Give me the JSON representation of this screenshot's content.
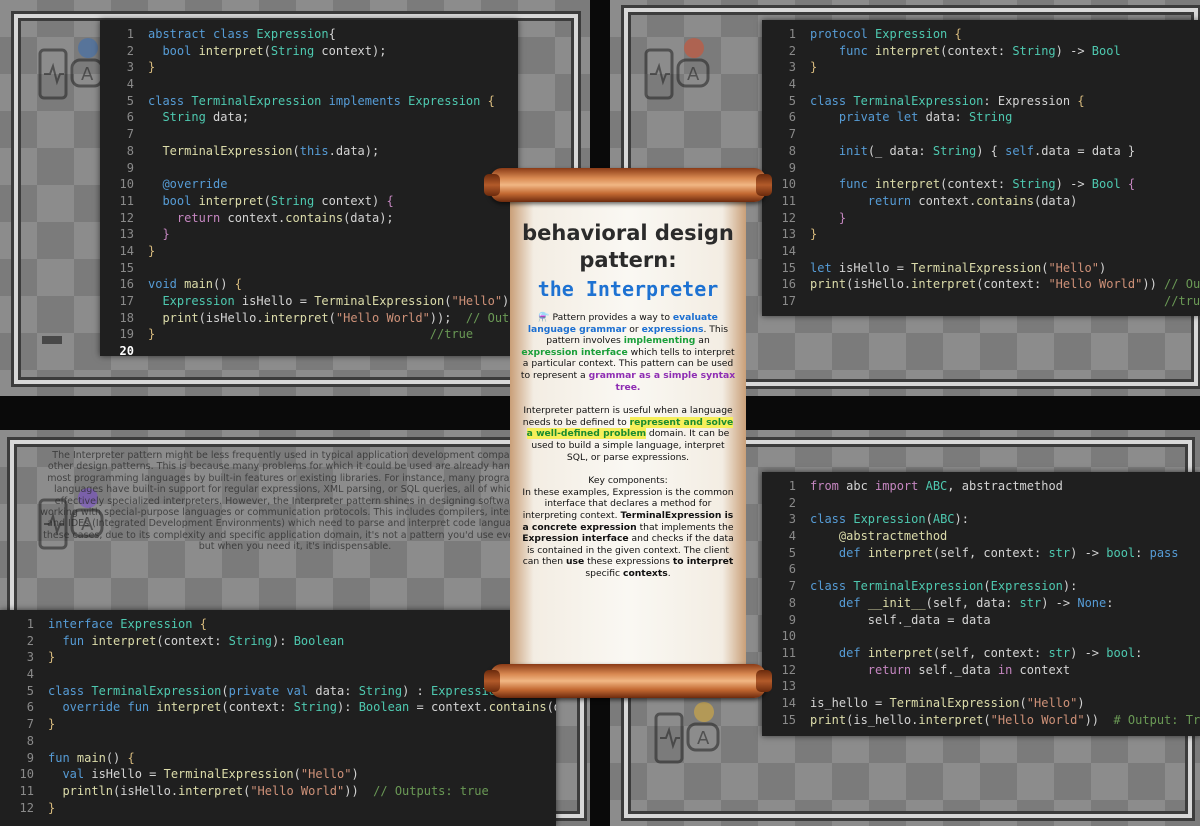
{
  "scroll": {
    "title_line1": "behavioral design",
    "title_line2": "pattern:",
    "title_line3": "the Interpreter",
    "p1_prefix": "⚗️ Pattern  provides a way to ",
    "p1_hl1": "evaluate language grammar",
    "p1_t1": " or ",
    "p1_hl2": "expressions",
    "p1_t2": ". This pattern involves ",
    "p1_hl3": "implementing",
    "p1_t3": " an ",
    "p1_hl4": "expression interface",
    "p1_t4": " which tells to interpret a particular context. This pattern can be used to represent a ",
    "p1_hl5": "grammar as a simple syntax tree.",
    "p2_t1": "Interpreter pattern is useful when a language needs to be defined to ",
    "p2_hl1": "represent and solve a well-defined problem",
    "p2_t2": " domain. It can be used to build a simple language, interpret SQL, or parse expressions.",
    "p3_heading": "Key components:",
    "p3_t1": "In these examples, Expression is the common interface that declares a method for interpreting context.",
    "p3_b1": "TerminalExpression is a concrete expression",
    "p3_t2": " that implements the ",
    "p3_b2": "Expression interface",
    "p3_t3": " and checks if the data is contained in the given context. The client can then ",
    "p3_b3": "use",
    "p3_t4": " these expressions ",
    "p3_b4": "to interpret",
    "p3_t5": " specific ",
    "p3_b5": "contexts",
    "p3_t6": "."
  },
  "side_text": "The Interpreter pattern might be less frequently used in typical application development compared to other design patterns. This is because many problems for which it could be used are already handled in most programming languages by built-in features or existing libraries. For instance, many programming languages have built-in support for regular expressions, XML parsing, or SQL queries, all of which are effectively specialized interpreters. However, the Interpreter pattern shines in designing software for working with special-purpose languages or communication protocols. This includes compilers, interpreters, and IDEs (Integrated Development Environments) which need to parse and interpret code languages. In these cases, due to its complexity and specific application domain, it's not a pattern you'd use every day, but when you need it, it's indispensable.",
  "code_dart": [
    [
      [
        "k",
        "abstract class "
      ],
      [
        "t",
        "Expression"
      ],
      [
        "",
        "{"
      ]
    ],
    [
      [
        "",
        "  "
      ],
      [
        "k",
        "bool "
      ],
      [
        "f",
        "interpret"
      ],
      [
        "",
        "("
      ],
      [
        "t",
        "String"
      ],
      [
        "",
        " context);"
      ]
    ],
    [
      [
        "y",
        "}"
      ]
    ],
    [],
    [
      [
        "k",
        "class "
      ],
      [
        "t",
        "TerminalExpression "
      ],
      [
        "k",
        "implements "
      ],
      [
        "t",
        "Expression "
      ],
      [
        "y",
        "{"
      ]
    ],
    [
      [
        "",
        "  "
      ],
      [
        "t",
        "String"
      ],
      [
        "",
        " data;"
      ]
    ],
    [],
    [
      [
        "",
        "  "
      ],
      [
        "f",
        "TerminalExpression"
      ],
      [
        "",
        "("
      ],
      [
        "k",
        "this"
      ],
      [
        "",
        ".data);"
      ]
    ],
    [],
    [
      [
        "",
        "  "
      ],
      [
        "k",
        "@override"
      ]
    ],
    [
      [
        "",
        "  "
      ],
      [
        "k",
        "bool "
      ],
      [
        "f",
        "interpret"
      ],
      [
        "",
        "("
      ],
      [
        "t",
        "String"
      ],
      [
        "",
        " context) "
      ],
      [
        "p",
        "{"
      ]
    ],
    [
      [
        "",
        "    "
      ],
      [
        "p",
        "return "
      ],
      [
        "",
        "context."
      ],
      [
        "f",
        "contains"
      ],
      [
        "",
        "(data);"
      ]
    ],
    [
      [
        "",
        "  "
      ],
      [
        "p",
        "}"
      ]
    ],
    [
      [
        "y",
        "}"
      ]
    ],
    [],
    [
      [
        "k",
        "void "
      ],
      [
        "f",
        "main"
      ],
      [
        "",
        "() "
      ],
      [
        "y",
        "{"
      ]
    ],
    [
      [
        "",
        "  "
      ],
      [
        "t",
        "Expression"
      ],
      [
        "",
        " isHello = "
      ],
      [
        "f",
        "TerminalExpression"
      ],
      [
        "",
        "("
      ],
      [
        "s",
        "\"Hello\""
      ],
      [
        "",
        ");"
      ]
    ],
    [
      [
        "",
        "  "
      ],
      [
        "f",
        "print"
      ],
      [
        "",
        "(isHello."
      ],
      [
        "f",
        "interpret"
      ],
      [
        "",
        "("
      ],
      [
        "s",
        "\"Hello World\""
      ],
      [
        "",
        "));  "
      ],
      [
        "c",
        "// Outputs:"
      ]
    ],
    [
      [
        "y",
        "}"
      ],
      [
        "",
        "                                      "
      ],
      [
        "c",
        "//true"
      ]
    ],
    []
  ],
  "code_swift": [
    [
      [
        "k",
        "protocol "
      ],
      [
        "t",
        "Expression "
      ],
      [
        "y",
        "{"
      ]
    ],
    [
      [
        "",
        "    "
      ],
      [
        "k",
        "func "
      ],
      [
        "f",
        "interpret"
      ],
      [
        "",
        "(context: "
      ],
      [
        "t",
        "String"
      ],
      [
        "",
        ") -> "
      ],
      [
        "t",
        "Bool"
      ]
    ],
    [
      [
        "y",
        "}"
      ]
    ],
    [],
    [
      [
        "k",
        "class "
      ],
      [
        "t",
        "TerminalExpression"
      ],
      [
        "",
        ": Expression "
      ],
      [
        "y",
        "{"
      ]
    ],
    [
      [
        "",
        "    "
      ],
      [
        "k",
        "private let "
      ],
      [
        "",
        "data: "
      ],
      [
        "t",
        "String"
      ]
    ],
    [],
    [
      [
        "",
        "    "
      ],
      [
        "k",
        "init"
      ],
      [
        "",
        "(_ data: "
      ],
      [
        "t",
        "String"
      ],
      [
        "",
        ") { "
      ],
      [
        "k",
        "self"
      ],
      [
        "",
        ".data = data }"
      ]
    ],
    [],
    [
      [
        "",
        "    "
      ],
      [
        "k",
        "func "
      ],
      [
        "f",
        "interpret"
      ],
      [
        "",
        "(context: "
      ],
      [
        "t",
        "String"
      ],
      [
        "",
        ") -> "
      ],
      [
        "t",
        "Bool "
      ],
      [
        "p",
        "{"
      ]
    ],
    [
      [
        "",
        "        "
      ],
      [
        "k",
        "return "
      ],
      [
        "",
        "context."
      ],
      [
        "f",
        "contains"
      ],
      [
        "",
        "(data)"
      ]
    ],
    [
      [
        "",
        "    "
      ],
      [
        "p",
        "}"
      ]
    ],
    [
      [
        "y",
        "}"
      ]
    ],
    [],
    [
      [
        "k",
        "let "
      ],
      [
        "",
        "isHello = "
      ],
      [
        "f",
        "TerminalExpression"
      ],
      [
        "",
        "("
      ],
      [
        "s",
        "\"Hello\""
      ],
      [
        "",
        ")"
      ]
    ],
    [
      [
        "f",
        "print"
      ],
      [
        "",
        "(isHello."
      ],
      [
        "f",
        "interpret"
      ],
      [
        "",
        "(context: "
      ],
      [
        "s",
        "\"Hello World\""
      ],
      [
        "",
        ")) "
      ],
      [
        "c",
        "// Outputs:"
      ]
    ],
    [
      [
        "",
        "                                                 "
      ],
      [
        "c",
        "//true"
      ]
    ]
  ],
  "code_kotlin": [
    [
      [
        "k",
        "interface "
      ],
      [
        "t",
        "Expression "
      ],
      [
        "y",
        "{"
      ]
    ],
    [
      [
        "",
        "  "
      ],
      [
        "k",
        "fun "
      ],
      [
        "f",
        "interpret"
      ],
      [
        "",
        "(context: "
      ],
      [
        "t",
        "String"
      ],
      [
        "",
        "): "
      ],
      [
        "t",
        "Boolean"
      ]
    ],
    [
      [
        "y",
        "}"
      ]
    ],
    [],
    [
      [
        "k",
        "class "
      ],
      [
        "t",
        "TerminalExpression"
      ],
      [
        "",
        "("
      ],
      [
        "k",
        "private val "
      ],
      [
        "",
        "data: "
      ],
      [
        "t",
        "String"
      ],
      [
        "",
        ") : "
      ],
      [
        "t",
        "Expression "
      ],
      [
        "y",
        "{"
      ]
    ],
    [
      [
        "",
        "  "
      ],
      [
        "k",
        "override fun "
      ],
      [
        "f",
        "interpret"
      ],
      [
        "",
        "(context: "
      ],
      [
        "t",
        "String"
      ],
      [
        "",
        "): "
      ],
      [
        "t",
        "Boolean"
      ],
      [
        "",
        " = context."
      ],
      [
        "f",
        "contains"
      ],
      [
        "",
        "(data)"
      ]
    ],
    [
      [
        "y",
        "}"
      ]
    ],
    [],
    [
      [
        "k",
        "fun "
      ],
      [
        "f",
        "main"
      ],
      [
        "",
        "() "
      ],
      [
        "y",
        "{"
      ]
    ],
    [
      [
        "",
        "  "
      ],
      [
        "k",
        "val "
      ],
      [
        "",
        "isHello = "
      ],
      [
        "f",
        "TerminalExpression"
      ],
      [
        "",
        "("
      ],
      [
        "s",
        "\"Hello\""
      ],
      [
        "",
        ")"
      ]
    ],
    [
      [
        "",
        "  "
      ],
      [
        "f",
        "println"
      ],
      [
        "",
        "(isHello."
      ],
      [
        "f",
        "interpret"
      ],
      [
        "",
        "("
      ],
      [
        "s",
        "\"Hello World\""
      ],
      [
        "",
        "))  "
      ],
      [
        "c",
        "// Outputs: true"
      ]
    ],
    [
      [
        "y",
        "}"
      ]
    ]
  ],
  "code_python": [
    [
      [
        "p",
        "from "
      ],
      [
        "",
        "abc "
      ],
      [
        "p",
        "import "
      ],
      [
        "t",
        "ABC"
      ],
      [
        "",
        ", abstractmethod"
      ]
    ],
    [],
    [
      [
        "k",
        "class "
      ],
      [
        "t",
        "Expression"
      ],
      [
        "",
        "("
      ],
      [
        "t",
        "ABC"
      ],
      [
        "",
        "):"
      ]
    ],
    [
      [
        "",
        "    "
      ],
      [
        "f",
        "@abstractmethod"
      ]
    ],
    [
      [
        "",
        "    "
      ],
      [
        "k",
        "def "
      ],
      [
        "f",
        "interpret"
      ],
      [
        "",
        "(self, context: "
      ],
      [
        "t",
        "str"
      ],
      [
        "",
        ") -> "
      ],
      [
        "t",
        "bool"
      ],
      [
        "",
        ": "
      ],
      [
        "k",
        "pass"
      ]
    ],
    [],
    [
      [
        "k",
        "class "
      ],
      [
        "t",
        "TerminalExpression"
      ],
      [
        "",
        "("
      ],
      [
        "t",
        "Expression"
      ],
      [
        "",
        "):"
      ]
    ],
    [
      [
        "",
        "    "
      ],
      [
        "k",
        "def "
      ],
      [
        "f",
        "__init__"
      ],
      [
        "",
        "(self, data: "
      ],
      [
        "t",
        "str"
      ],
      [
        "",
        ") -> "
      ],
      [
        "k",
        "None"
      ],
      [
        "",
        ":"
      ]
    ],
    [
      [
        "",
        "        self._data = data"
      ]
    ],
    [],
    [
      [
        "",
        "    "
      ],
      [
        "k",
        "def "
      ],
      [
        "f",
        "interpret"
      ],
      [
        "",
        "(self, context: "
      ],
      [
        "t",
        "str"
      ],
      [
        "",
        ") -> "
      ],
      [
        "t",
        "bool"
      ],
      [
        "",
        ":"
      ]
    ],
    [
      [
        "",
        "        "
      ],
      [
        "p",
        "return "
      ],
      [
        "",
        "self._data "
      ],
      [
        "p",
        "in "
      ],
      [
        "",
        "context"
      ]
    ],
    [],
    [
      [
        "",
        "is_hello = "
      ],
      [
        "f",
        "TerminalExpression"
      ],
      [
        "",
        "("
      ],
      [
        "s",
        "\"Hello\""
      ],
      [
        "",
        ")"
      ]
    ],
    [
      [
        "f",
        "print"
      ],
      [
        "",
        "(is_hello."
      ],
      [
        "f",
        "interpret"
      ],
      [
        "",
        "("
      ],
      [
        "s",
        "\"Hello World\""
      ],
      [
        "",
        "))  "
      ],
      [
        "c",
        "# Output: True"
      ]
    ]
  ]
}
